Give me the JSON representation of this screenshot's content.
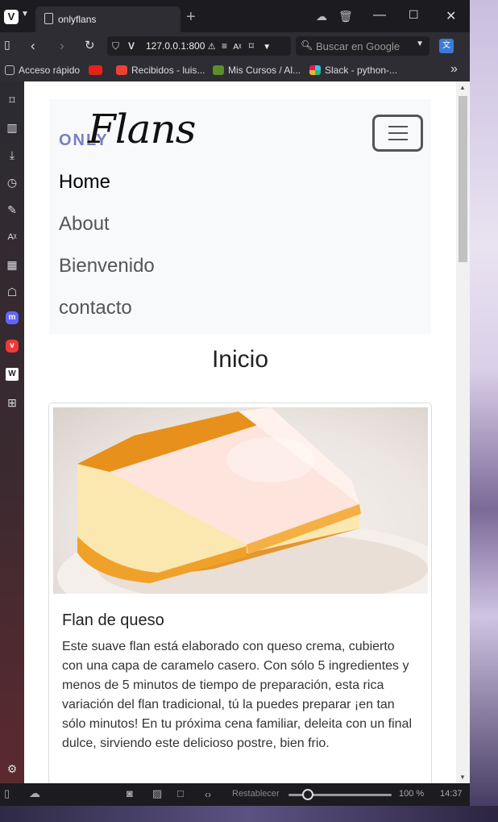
{
  "browser": {
    "tab_title": "onlyflans",
    "url": "127.0.0.1:800",
    "search_placeholder": "Buscar en Google",
    "bookmarks": [
      "Acceso rápido",
      "Recibidos - luis...",
      "Mis Cursos / Al...",
      "Slack - python-..."
    ],
    "more_bookmarks": "»"
  },
  "site": {
    "brand_prefix": "ONLY",
    "brand_name": "Flans",
    "nav_items": [
      "Home",
      "About",
      "Bienvenido",
      "contacto"
    ],
    "page_title": "Inicio",
    "card": {
      "title": "Flan de queso",
      "text": "Este suave flan está elaborado con queso crema, cubierto con una capa de caramelo casero. Con sólo 5 ingredientes y menos de 5 minutos de tiempo de preparación, esta rica variación del flan tradicional, tú la puedes preparar ¡en tan sólo minutos! En tu próxima cena familiar, deleita con un final dulce, sirviendo este delicioso postre, bien frio."
    }
  },
  "statusbar": {
    "reset_label": "Restablecer",
    "zoom": "100 %",
    "time": "14:37"
  },
  "colors": {
    "brand_accent": "#7a7fbf",
    "navbar_bg": "#f8f9fa",
    "caramel": "#f0a12a"
  }
}
